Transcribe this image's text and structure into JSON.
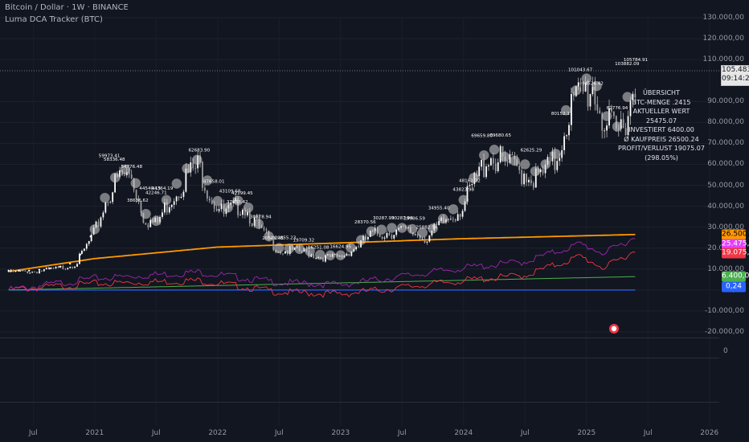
{
  "header": {
    "symbol_line": "Bitcoin / Dollar · 1W · BINANCE",
    "indicator_line": "Luma DCA Tracker (BTC)"
  },
  "price_axis": {
    "labels": [
      {
        "label": "130.000,00",
        "value": 130000
      },
      {
        "label": "120.000,00",
        "value": 120000
      },
      {
        "label": "110.000,00",
        "value": 110000
      },
      {
        "label": "90.000,00",
        "value": 90000
      },
      {
        "label": "80.000,00",
        "value": 80000
      },
      {
        "label": "70.000,00",
        "value": 70000
      },
      {
        "label": "60.000,00",
        "value": 60000
      },
      {
        "label": "50.000,00",
        "value": 50000
      },
      {
        "label": "40.000,00",
        "value": 40000
      },
      {
        "label": "30.000,00",
        "value": 30000
      },
      {
        "label": "20.000,00",
        "value": 20000
      },
      {
        "label": "10.000,00",
        "value": 10000
      },
      {
        "label": "0,00",
        "value": 0
      },
      {
        "label": "-10.000,00",
        "value": -10000
      },
      {
        "label": "-20.000,00",
        "value": -20000
      }
    ]
  },
  "last_price": {
    "value": "105.483,68",
    "countdown": "09:14:23"
  },
  "series_tags": [
    {
      "text": "26.500,24",
      "value": 26500,
      "color": "#ff9800",
      "fg": "#000000"
    },
    {
      "text": "25.475,07",
      "value": 22000,
      "color": "#e040fb",
      "fg": "#ffffff"
    },
    {
      "text": "19.075,07",
      "value": 17500,
      "color": "#f23645",
      "fg": "#ffffff"
    },
    {
      "text": "6.400,00",
      "value": 6400,
      "color": "#4caf50",
      "fg": "#ffffff"
    },
    {
      "text": "0,24",
      "value": 1500,
      "color": "#2962ff",
      "fg": "#ffffff"
    }
  ],
  "overview": {
    "title": "ÜBERSICHT",
    "rows": [
      {
        "label": "BTC-MENGE",
        "value": ".2415"
      },
      {
        "label": "AKTUELLER WERT",
        "value": "25475.07"
      },
      {
        "label": "INVESTIERT",
        "value": "6400.00"
      },
      {
        "label": "Ø KAUFPREIS",
        "value": "26500.24"
      },
      {
        "label": "PROFIT/VERLUST",
        "value": "19075.07  (298.05%)"
      }
    ]
  },
  "sub_pane": {
    "zero_label": "0"
  },
  "time_axis": [
    {
      "label": "Jul",
      "t": 2020.5
    },
    {
      "label": "2021",
      "t": 2021.0
    },
    {
      "label": "Jul",
      "t": 2021.5
    },
    {
      "label": "2022",
      "t": 2022.0
    },
    {
      "label": "Jul",
      "t": 2022.5
    },
    {
      "label": "2023",
      "t": 2023.0
    },
    {
      "label": "Jul",
      "t": 2023.5
    },
    {
      "label": "2024",
      "t": 2024.0
    },
    {
      "label": "Jul",
      "t": 2024.5
    },
    {
      "label": "2025",
      "t": 2025.0
    },
    {
      "label": "Jul",
      "t": 2025.5
    },
    {
      "label": "2026",
      "t": 2026.0
    }
  ],
  "chart_data": {
    "type": "line",
    "btc_price": [
      [
        2020.3,
        9200
      ],
      [
        2020.5,
        9300
      ],
      [
        2020.7,
        10800
      ],
      [
        2020.85,
        13500
      ],
      [
        2021.0,
        29000
      ],
      [
        2021.1,
        47000
      ],
      [
        2021.2,
        57000
      ],
      [
        2021.3,
        58000
      ],
      [
        2021.4,
        37000
      ],
      [
        2021.5,
        33000
      ],
      [
        2021.6,
        45000
      ],
      [
        2021.75,
        58000
      ],
      [
        2021.85,
        63000
      ],
      [
        2021.95,
        47000
      ],
      [
        2022.05,
        38000
      ],
      [
        2022.2,
        44000
      ],
      [
        2022.35,
        30000
      ],
      [
        2022.5,
        20000
      ],
      [
        2022.7,
        19500
      ],
      [
        2022.85,
        16500
      ],
      [
        2023.0,
        16600
      ],
      [
        2023.15,
        23000
      ],
      [
        2023.25,
        28000
      ],
      [
        2023.45,
        30000
      ],
      [
        2023.6,
        29000
      ],
      [
        2023.7,
        26500
      ],
      [
        2023.85,
        35000
      ],
      [
        2024.0,
        43000
      ],
      [
        2024.15,
        62000
      ],
      [
        2024.2,
        69000
      ],
      [
        2024.35,
        63000
      ],
      [
        2024.5,
        60000
      ],
      [
        2024.6,
        56000
      ],
      [
        2024.75,
        65000
      ],
      [
        2024.85,
        90000
      ],
      [
        2024.95,
        98000
      ],
      [
        2025.05,
        104000
      ],
      [
        2025.15,
        84000
      ],
      [
        2025.25,
        78000
      ],
      [
        2025.35,
        95000
      ],
      [
        2025.4,
        105500
      ]
    ],
    "labeled_points": [
      [
        2021.12,
        59973.41
      ],
      [
        2021.16,
        58336.48
      ],
      [
        2021.3,
        54776.48
      ],
      [
        2021.45,
        44540.15
      ],
      [
        2021.55,
        44364.19
      ],
      [
        2021.5,
        42246.71
      ],
      [
        2021.35,
        38636.62
      ],
      [
        2021.85,
        62683.9
      ],
      [
        2021.97,
        47658.01
      ],
      [
        2022.1,
        43109.68
      ],
      [
        2022.2,
        42199.45
      ],
      [
        2022.16,
        37933.42
      ],
      [
        2022.35,
        30878.94
      ],
      [
        2022.45,
        20576.45
      ],
      [
        2022.55,
        20855.23
      ],
      [
        2022.7,
        19709.32
      ],
      [
        2022.82,
        16251.08
      ],
      [
        2023.0,
        16624.95
      ],
      [
        2023.2,
        28370.56
      ],
      [
        2023.35,
        30287.99
      ],
      [
        2023.5,
        30287.94
      ],
      [
        2023.6,
        29986.59
      ],
      [
        2023.7,
        25882.54
      ],
      [
        2023.8,
        34955.4
      ],
      [
        2024.0,
        43823.98
      ],
      [
        2024.05,
        48162.32
      ],
      [
        2024.15,
        69659.8
      ],
      [
        2024.3,
        69680.65
      ],
      [
        2024.55,
        62625.29
      ],
      [
        2024.8,
        80152.11
      ],
      [
        2024.95,
        101043.67
      ],
      [
        2025.05,
        94526.42
      ],
      [
        2025.25,
        82776.94
      ],
      [
        2025.33,
        103882.09
      ],
      [
        2025.4,
        105784.91
      ]
    ],
    "avg_buy_price": [
      [
        2020.3,
        8800
      ],
      [
        2021.0,
        15000
      ],
      [
        2022.0,
        20500
      ],
      [
        2023.0,
        22500
      ],
      [
        2024.0,
        24500
      ],
      [
        2025.4,
        26500.24
      ]
    ],
    "current_value": [
      [
        2020.3,
        0
      ],
      [
        2021.0,
        5500
      ],
      [
        2021.85,
        8500
      ],
      [
        2022.5,
        3500
      ],
      [
        2023.0,
        2500
      ],
      [
        2024.0,
        10500
      ],
      [
        2024.5,
        13500
      ],
      [
        2024.95,
        22000
      ],
      [
        2025.15,
        17500
      ],
      [
        2025.4,
        25475.07
      ]
    ],
    "profit_loss": [
      [
        2020.3,
        0
      ],
      [
        2021.0,
        3000
      ],
      [
        2021.85,
        4500
      ],
      [
        2022.5,
        -1000
      ],
      [
        2023.0,
        -2000
      ],
      [
        2024.0,
        4500
      ],
      [
        2024.5,
        7000
      ],
      [
        2024.95,
        16000
      ],
      [
        2025.15,
        10500
      ],
      [
        2025.4,
        19075.07
      ]
    ],
    "invested": [
      [
        2020.3,
        0
      ],
      [
        2025.4,
        6400
      ]
    ],
    "btc_amount": [
      [
        2020.3,
        0
      ],
      [
        2025.4,
        0.24
      ]
    ]
  }
}
